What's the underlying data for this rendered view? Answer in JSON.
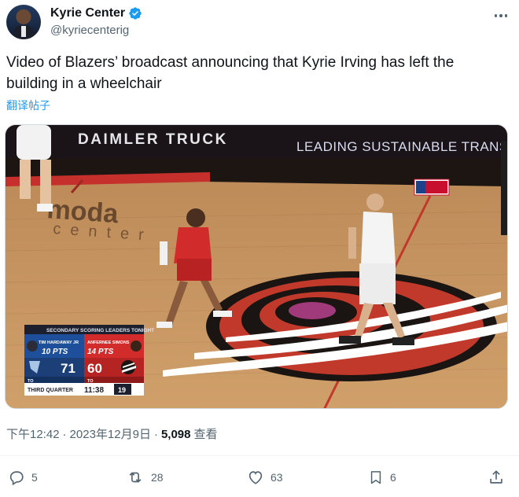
{
  "author": {
    "display_name": "Kyrie Center",
    "handle": "@kyriecenterig",
    "verified": true
  },
  "tweet": {
    "text": "Video of Blazers’ broadcast announcing that Kyrie Irving has left the building in a wheelchair",
    "translate_label": "翻译帖子",
    "time": "下午12:42",
    "separator": "·",
    "date": "2023年12月9日",
    "separator2": "·",
    "views_count": "5,098",
    "views_label": "查看"
  },
  "media": {
    "banner_left": "DAIMLER TRUCK",
    "banner_right": "LEADING SUSTAINABLE TRANS",
    "court_logo_top": "moda",
    "court_logo_bottom": "center",
    "scoreboard": {
      "header": "SECONDARY SCORING LEADERS TONIGHT",
      "player_left_name": "TIM HARDAWAY JR",
      "player_left_pts": "10 PTS",
      "player_right_name": "ANFERNEE SIMONS",
      "player_right_pts": "14 PTS",
      "score_left": "71",
      "score_right": "60",
      "to_left": "TO",
      "to_right": "TO",
      "quarter": "THIRD QUARTER",
      "clock": "11:38",
      "shot_clock": "19"
    }
  },
  "actions": {
    "replies": "5",
    "retweets": "28",
    "likes": "63",
    "bookmarks": "6"
  },
  "colors": {
    "accent": "#1d9bf0",
    "secondary_text": "#536471",
    "mavs_blue": "#1d4f9a",
    "blazers_red": "#d22b2b"
  },
  "icons": [
    "verified-badge-icon",
    "more-icon",
    "reply-icon",
    "retweet-icon",
    "like-icon",
    "bookmark-icon",
    "share-icon"
  ]
}
